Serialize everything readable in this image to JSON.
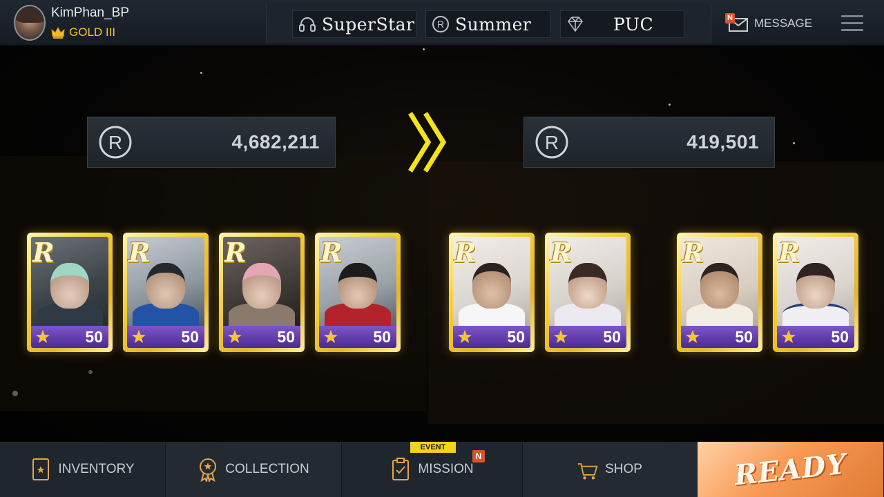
{
  "profile": {
    "username": "KimPhan_BP",
    "rank": "GOLD III"
  },
  "theme": {
    "superstar_label": "SuperStar",
    "summer_label": "Summer",
    "puc_label": "PUC"
  },
  "header": {
    "message_label": "MESSAGE",
    "message_badge": "N"
  },
  "score": {
    "before": "4,682,211",
    "after": "419,501"
  },
  "cards_before": [
    {
      "grade": "R",
      "level": "50"
    },
    {
      "grade": "R",
      "level": "50"
    },
    {
      "grade": "R",
      "level": "50"
    },
    {
      "grade": "R",
      "level": "50"
    }
  ],
  "cards_after": [
    {
      "grade": "R",
      "level": "50"
    },
    {
      "grade": "R",
      "level": "50"
    },
    {
      "grade": "R",
      "level": "50"
    },
    {
      "grade": "R",
      "level": "50"
    }
  ],
  "nav": {
    "inventory": "INVENTORY",
    "collection": "COLLECTION",
    "mission": "MISSION",
    "mission_event_tag": "EVENT",
    "mission_badge": "N",
    "shop": "SHOP",
    "ready": "READY"
  },
  "colors": {
    "gold": "#f3cf3e",
    "ready": "#f79a55",
    "card_bar": "#5b36a8",
    "chevron": "#f4e21a"
  },
  "icons": [
    "headphones-icon",
    "r-coin-icon",
    "diamond-icon",
    "mail-icon",
    "menu-icon",
    "card-icon",
    "medal-icon",
    "clipboard-icon",
    "cart-icon",
    "star-icon"
  ]
}
